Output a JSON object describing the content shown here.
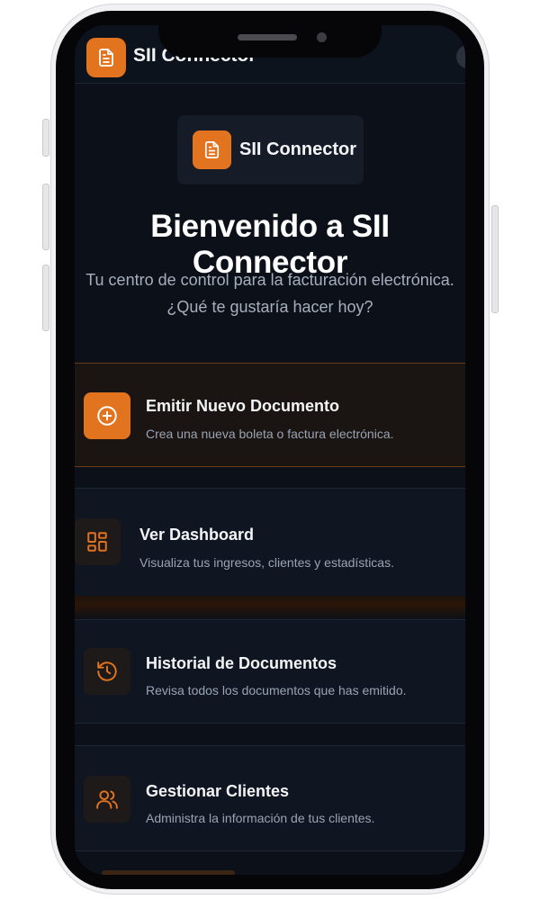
{
  "header": {
    "title": "SII Connector",
    "logo_icon": "document-icon"
  },
  "brand": {
    "name": "SII Connector",
    "logo_icon": "document-icon"
  },
  "hero": {
    "title": "Bienvenido a SII Connector",
    "subtitle_line1": "Tu centro de control para la facturación electrónica.",
    "subtitle_line2": "¿Qué te gustaría hacer hoy?"
  },
  "actions": [
    {
      "title": "Emitir Nuevo Documento",
      "description": "Crea una nueva boleta o factura electrónica.",
      "icon": "plus-circle-icon"
    },
    {
      "title": "Ver Dashboard",
      "description": "Visualiza tus ingresos, clientes y estadísticas.",
      "icon": "dashboard-grid-icon"
    },
    {
      "title": "Historial de Documentos",
      "description": "Revisa todos los documentos que has emitido.",
      "icon": "history-icon"
    },
    {
      "title": "Gestionar Clientes",
      "description": "Administra la información de tus clientes.",
      "icon": "users-icon"
    }
  ],
  "colors": {
    "accent": "#e2731f",
    "background": "#0b1019",
    "card": "#0f1622",
    "primary_card": "#1a1513"
  }
}
